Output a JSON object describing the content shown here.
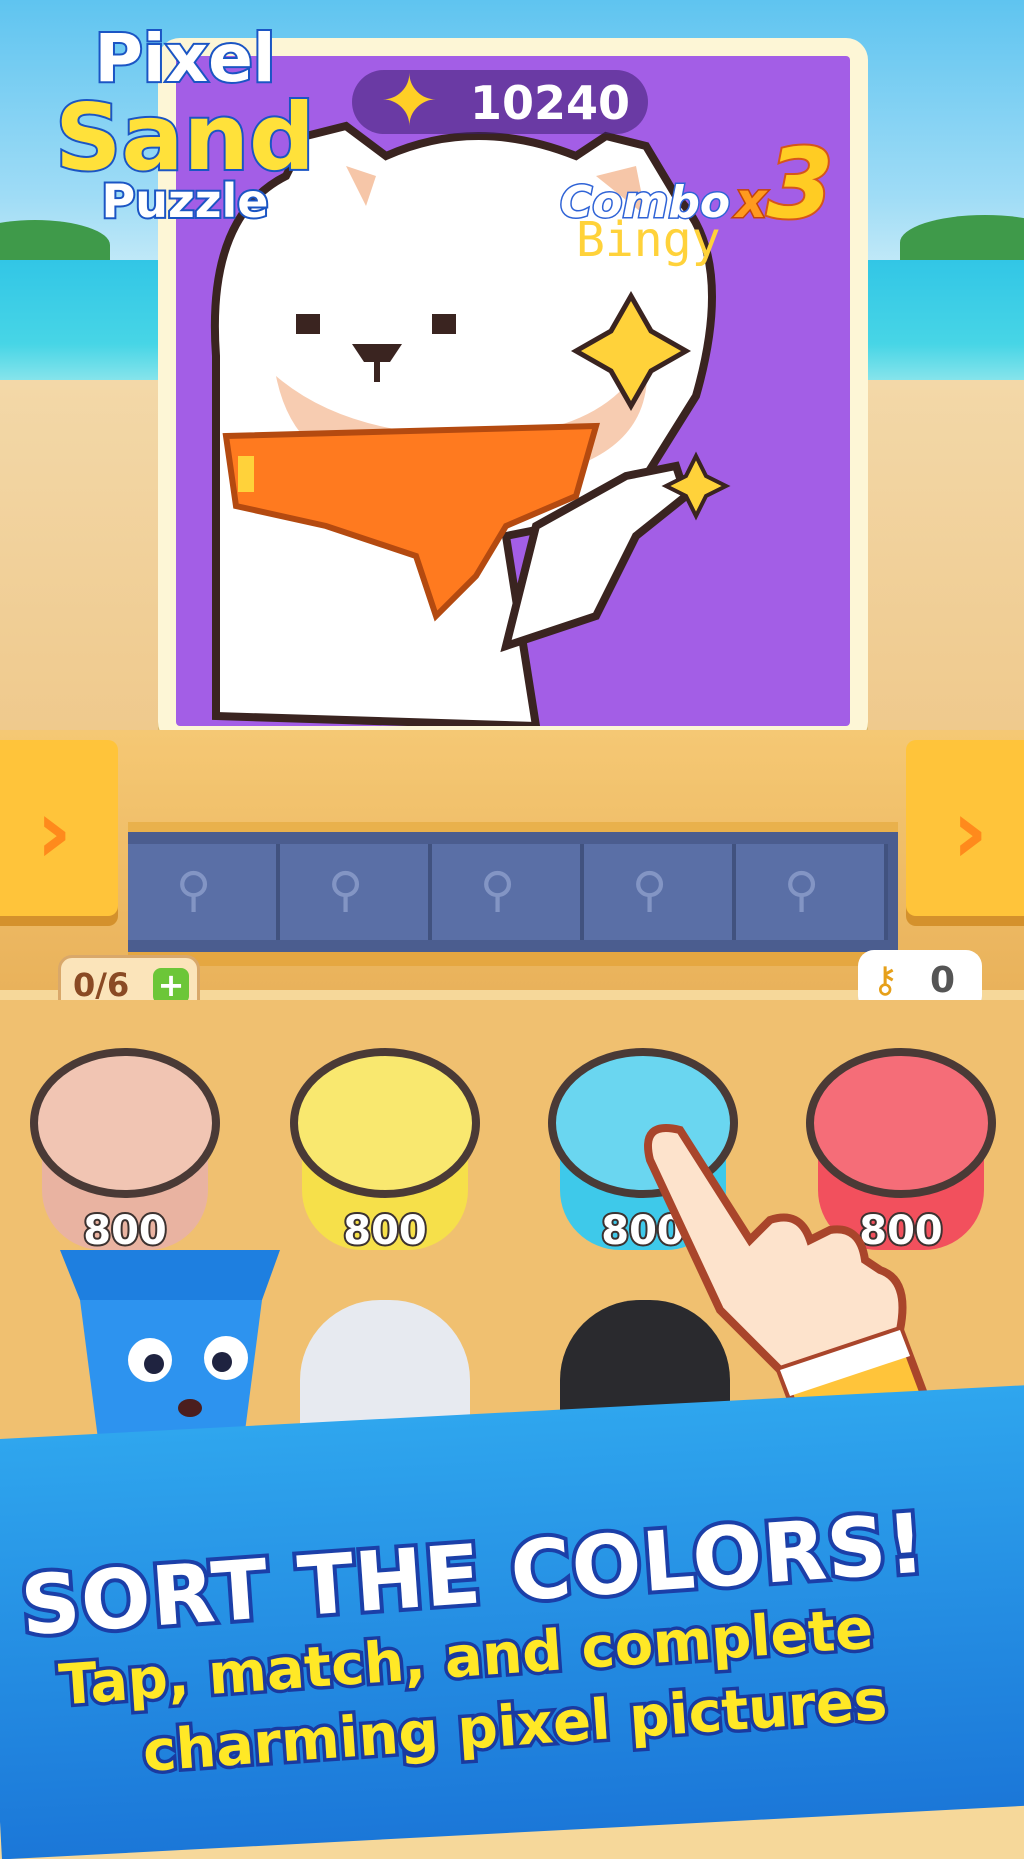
{
  "app": {
    "logo_line1": "Pixel",
    "logo_line2": "Sand",
    "logo_line3": "Puzzle"
  },
  "hud": {
    "score": "10240",
    "combo_label": "Combo",
    "combo_x": "x",
    "combo_value": "3",
    "moves": "0/6",
    "moves_add": "+",
    "keys": "0"
  },
  "picture": {
    "signature": "Bingy"
  },
  "buckets": [
    {
      "color": "#e9b3a1",
      "count": "800"
    },
    {
      "color": "#f6e04a",
      "count": "800"
    },
    {
      "color": "#3ec9ea",
      "count": "800"
    },
    {
      "color": "#f2505d",
      "count": "800"
    }
  ],
  "banner": {
    "headline": "SORT THE COLORS!",
    "line1": "Tap, match, and complete",
    "line2": "charming pixel pictures"
  },
  "colors": {
    "canvas_bg": "#a35ee6",
    "scarf": "#ff7a1f",
    "bear_face": "#f6c6a8",
    "belt": "#4b5d8f",
    "banner": "#1b77d8"
  },
  "icons": [
    "star-icon",
    "chevron-right-icon",
    "trowel-icon",
    "key-icon",
    "plus-icon",
    "pointing-hand-icon"
  ]
}
